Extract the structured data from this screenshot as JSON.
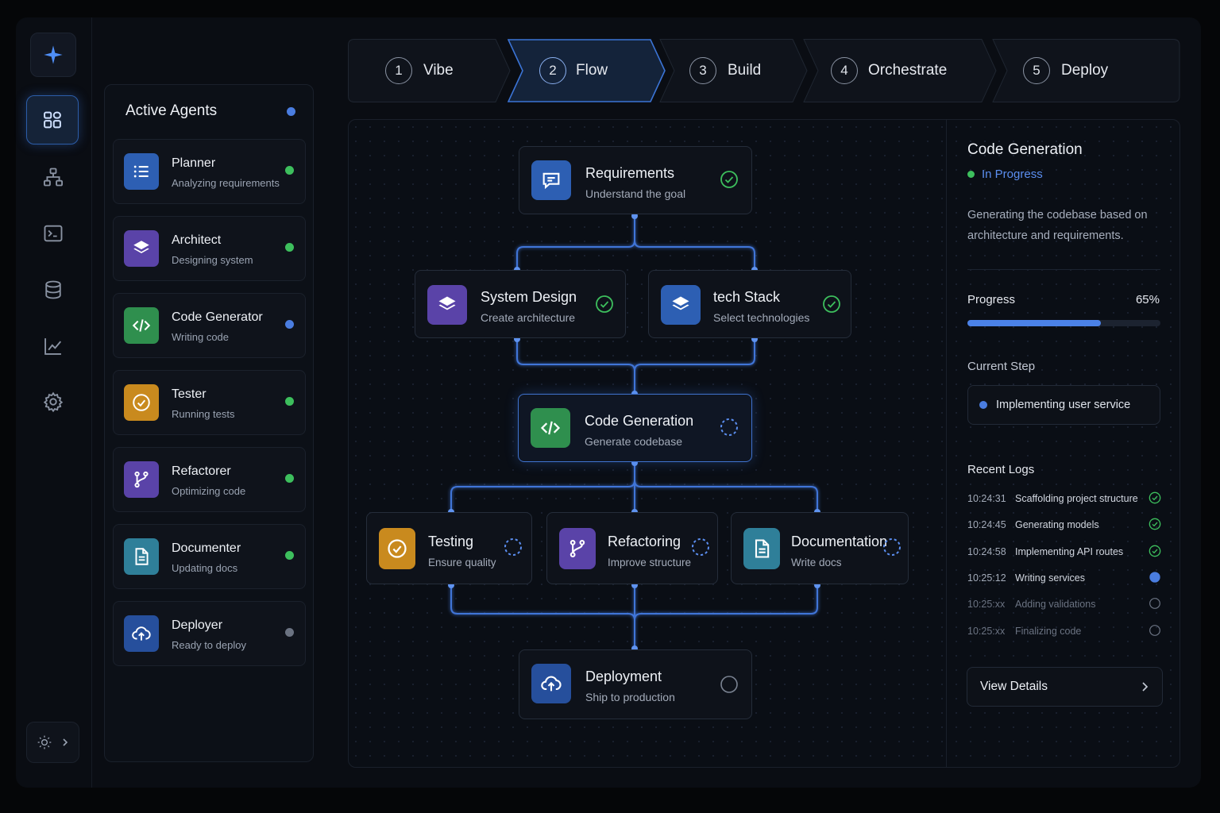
{
  "sidebar": {
    "icons": [
      "sparkle-logo-icon",
      "apps-icon",
      "hierarchy-icon",
      "terminal-icon",
      "database-icon",
      "chart-icon",
      "gear-icon"
    ],
    "theme_icon": "sun-icon"
  },
  "agents_panel": {
    "title": "Active Agents",
    "items": [
      {
        "name": "Planner",
        "status": "Analyzing requirements",
        "icon": "list-icon",
        "color": "#2d5fb3",
        "dot": "#3dbf5d"
      },
      {
        "name": "Architect",
        "status": "Designing system",
        "icon": "layers-icon",
        "color": "#5a43a8",
        "dot": "#3dbf5d"
      },
      {
        "name": "Code Generator",
        "status": "Writing code",
        "icon": "code-icon",
        "color": "#2f8f4e",
        "dot": "#4a7de0"
      },
      {
        "name": "Tester",
        "status": "Running tests",
        "icon": "check-circle-icon",
        "color": "#c98a1e",
        "dot": "#3dbf5d"
      },
      {
        "name": "Refactorer",
        "status": "Optimizing code",
        "icon": "branch-icon",
        "color": "#5a43a8",
        "dot": "#3dbf5d"
      },
      {
        "name": "Documenter",
        "status": "Updating docs",
        "icon": "document-icon",
        "color": "#2f7f99",
        "dot": "#3dbf5d"
      },
      {
        "name": "Deployer",
        "status": "Ready to deploy",
        "icon": "cloud-upload-icon",
        "color": "#264f9c",
        "dot": "#6b7382"
      }
    ]
  },
  "stepper": {
    "active_index": 1,
    "steps": [
      {
        "num": "1",
        "label": "Vibe"
      },
      {
        "num": "2",
        "label": "Flow"
      },
      {
        "num": "3",
        "label": "Build"
      },
      {
        "num": "4",
        "label": "Orchestrate"
      },
      {
        "num": "5",
        "label": "Deploy"
      }
    ]
  },
  "flow": {
    "requirements": {
      "title": "Requirements",
      "subtitle": "Understand the goal",
      "state": "done"
    },
    "system_design": {
      "title": "System Design",
      "subtitle": "Create architecture",
      "state": "done"
    },
    "tech_stack": {
      "title": "tech Stack",
      "subtitle": "Select technologies",
      "state": "done"
    },
    "code_generation": {
      "title": "Code Generation",
      "subtitle": "Generate codebase",
      "state": "in-progress"
    },
    "testing": {
      "title": "Testing",
      "subtitle": "Ensure quality",
      "state": "pending"
    },
    "refactoring": {
      "title": "Refactoring",
      "subtitle": "Improve structure",
      "state": "pending"
    },
    "documentation": {
      "title": "Documentation",
      "subtitle": "Write docs",
      "state": "pending"
    },
    "deployment": {
      "title": "Deployment",
      "subtitle": "Ship to production",
      "state": "not-started"
    }
  },
  "details": {
    "title": "Code Generation",
    "status": "In Progress",
    "description": "Generating the codebase based on architecture and requirements.",
    "progress_label": "Progress",
    "progress_value": "65%",
    "progress_fraction": 0.69,
    "current_step_label": "Current Step",
    "current_step": "Implementing user service",
    "logs_label": "Recent Logs",
    "logs": [
      {
        "time": "10:24:31",
        "text": "Scaffolding project structure",
        "state": "done"
      },
      {
        "time": "10:24:45",
        "text": "Generating models",
        "state": "done"
      },
      {
        "time": "10:24:58",
        "text": "Implementing API routes",
        "state": "done"
      },
      {
        "time": "10:25:12",
        "text": "Writing services",
        "state": "current"
      },
      {
        "time": "10:25:xx",
        "text": "Adding validations",
        "state": "pending"
      },
      {
        "time": "10:25:xx",
        "text": "Finalizing code",
        "state": "pending"
      }
    ],
    "button_label": "View Details"
  }
}
